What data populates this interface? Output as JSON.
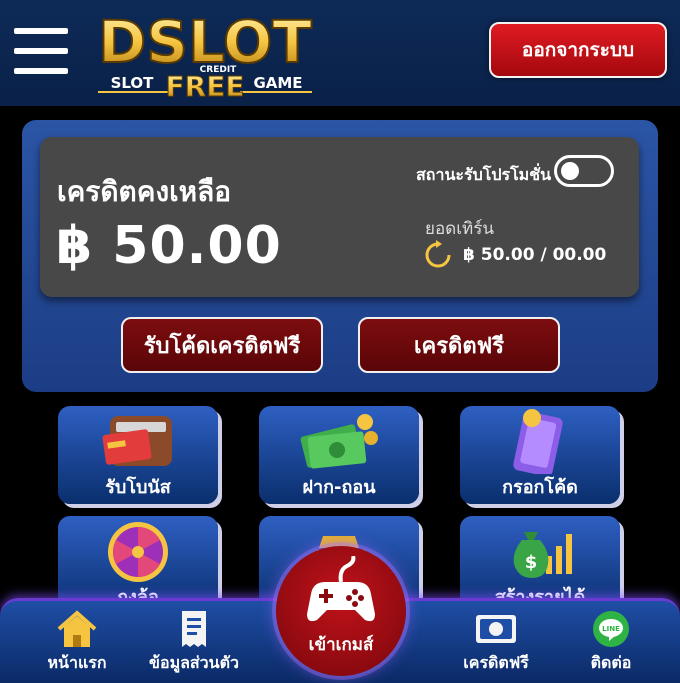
{
  "header": {
    "logo": {
      "main": "DSLOT",
      "left": "SLOT",
      "center": "FREE",
      "credit": "CREDIT",
      "right": "GAME"
    },
    "logout_label": "ออกจากระบบ"
  },
  "credit": {
    "title": "เครดิตคงเหลือ",
    "amount": "฿ 50.00",
    "promo_status_label": "สถานะรับโปรโมชั่น",
    "promo_enabled": false,
    "turnover_label": "ยอดเทิร์น",
    "turnover_value": "฿ 50.00 / 00.00"
  },
  "buttons": {
    "redeem_code": "รับโค้ดเครดิตฟรี",
    "free_credit": "เครดิตฟรี"
  },
  "menu": {
    "items": [
      {
        "label": "รับโบนัส",
        "icon": "wallet-card-icon"
      },
      {
        "label": "ฝาก-ถอน",
        "icon": "money-coins-icon"
      },
      {
        "label": "กรอกโค้ด",
        "icon": "phone-coin-icon"
      },
      {
        "label": "กงล้อ",
        "icon": "prize-wheel-icon"
      },
      {
        "label": "",
        "icon": "gold-bars-icon"
      },
      {
        "label": "สร้างรายได้",
        "icon": "money-bag-chart-icon"
      }
    ]
  },
  "bottom_nav": {
    "home": "หน้าแรก",
    "profile": "ข้อมูลส่วนตัว",
    "play": "เข้าเกมส์",
    "free_credit": "เครดิตฟรี",
    "contact": "ติดต่อ"
  },
  "colors": {
    "header_bg": "#0d2a57",
    "panel_blue": "#2b55a5",
    "credit_box": "#484848",
    "button_red": "#7d0d10",
    "logout_red": "#e01b22",
    "gold": "#f5c542"
  }
}
